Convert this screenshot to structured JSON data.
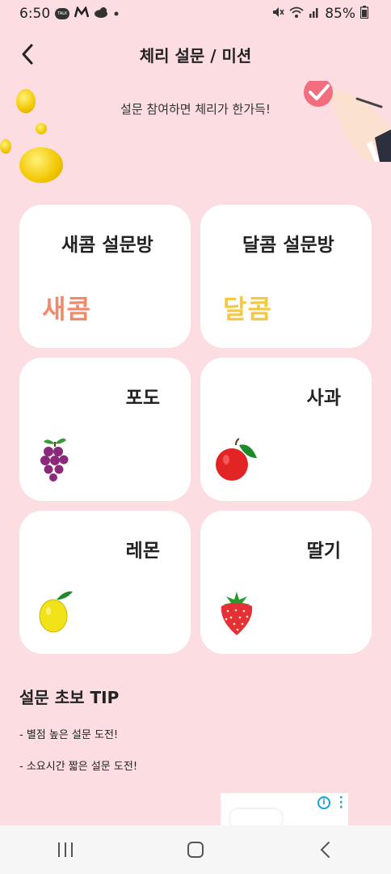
{
  "status_bar": {
    "time": "6:50",
    "battery": "85%",
    "icons": [
      "kakaotalk-icon",
      "m-app-icon",
      "weather-icon",
      "dot-icon",
      "mute-icon",
      "wifi-icon",
      "signal-icon",
      "battery-icon"
    ]
  },
  "header": {
    "title": "체리 설문 / 미션",
    "back_icon": "chevron-left-icon"
  },
  "banner": {
    "text": "설문 참여하면 체리가 한가득!"
  },
  "cards": [
    {
      "title": "새콤 설문방",
      "art_text": "새콤",
      "art_color": "#f08a6a"
    },
    {
      "title": "달콤 설문방",
      "art_text": "달콤",
      "art_color": "#f5c842"
    },
    {
      "title": "포도",
      "icon": "grape-icon"
    },
    {
      "title": "사과",
      "icon": "apple-icon"
    },
    {
      "title": "레몬",
      "icon": "lemon-icon"
    },
    {
      "title": "딸기",
      "icon": "strawberry-icon"
    }
  ],
  "tips": {
    "title": "설문 초보 TIP",
    "items": [
      "- 별점 높은 설문 도전!",
      "- 소요시간 짧은 설문 도전!"
    ]
  },
  "ad": {
    "info_icon": "info-icon",
    "menu_icon": "kebab-menu-icon"
  },
  "navbar": {
    "buttons": [
      "recent-apps-icon",
      "home-icon",
      "back-icon"
    ]
  },
  "colors": {
    "background": "#fbdde2",
    "card": "#ffffff",
    "nav": "#f6f6f6"
  }
}
